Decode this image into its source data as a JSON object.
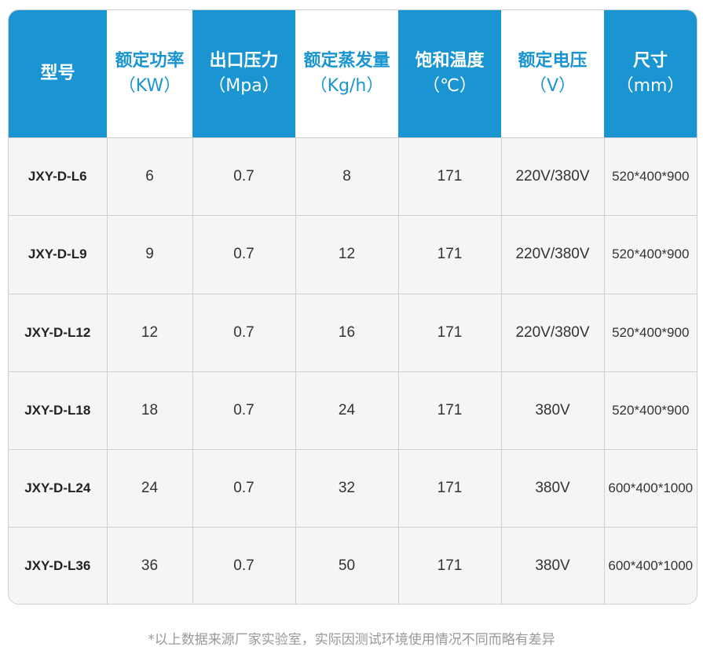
{
  "table": {
    "headers": [
      {
        "line1": "型号",
        "line2": ""
      },
      {
        "line1": "额定功率",
        "line2": "（KW）"
      },
      {
        "line1": "出口压力",
        "line2": "（Mpa）"
      },
      {
        "line1": "额定蒸发量",
        "line2": "（Kg/h）"
      },
      {
        "line1": "饱和温度",
        "line2": "（℃）"
      },
      {
        "line1": "额定电压",
        "line2": "（V）"
      },
      {
        "line1": "尺寸",
        "line2": "（mm）"
      }
    ],
    "rows": [
      [
        "JXY-D-L6",
        "6",
        "0.7",
        "8",
        "171",
        "220V/380V",
        "520*400*900"
      ],
      [
        "JXY-D-L9",
        "9",
        "0.7",
        "12",
        "171",
        "220V/380V",
        "520*400*900"
      ],
      [
        "JXY-D-L12",
        "12",
        "0.7",
        "16",
        "171",
        "220V/380V",
        "520*400*900"
      ],
      [
        "JXY-D-L18",
        "18",
        "0.7",
        "24",
        "171",
        "380V",
        "520*400*900"
      ],
      [
        "JXY-D-L24",
        "24",
        "0.7",
        "32",
        "171",
        "380V",
        "600*400*1000"
      ],
      [
        "JXY-D-L36",
        "36",
        "0.7",
        "50",
        "171",
        "380V",
        "600*400*1000"
      ]
    ]
  },
  "footnote": "*以上数据来源厂家实验室，实际因测试环境使用情况不同而略有差异",
  "colors": {
    "accent": "#1a95d2",
    "header_text_on_white": "#1a95d2",
    "row_bg": "#f5f5f5",
    "border": "#cfcfcf"
  }
}
